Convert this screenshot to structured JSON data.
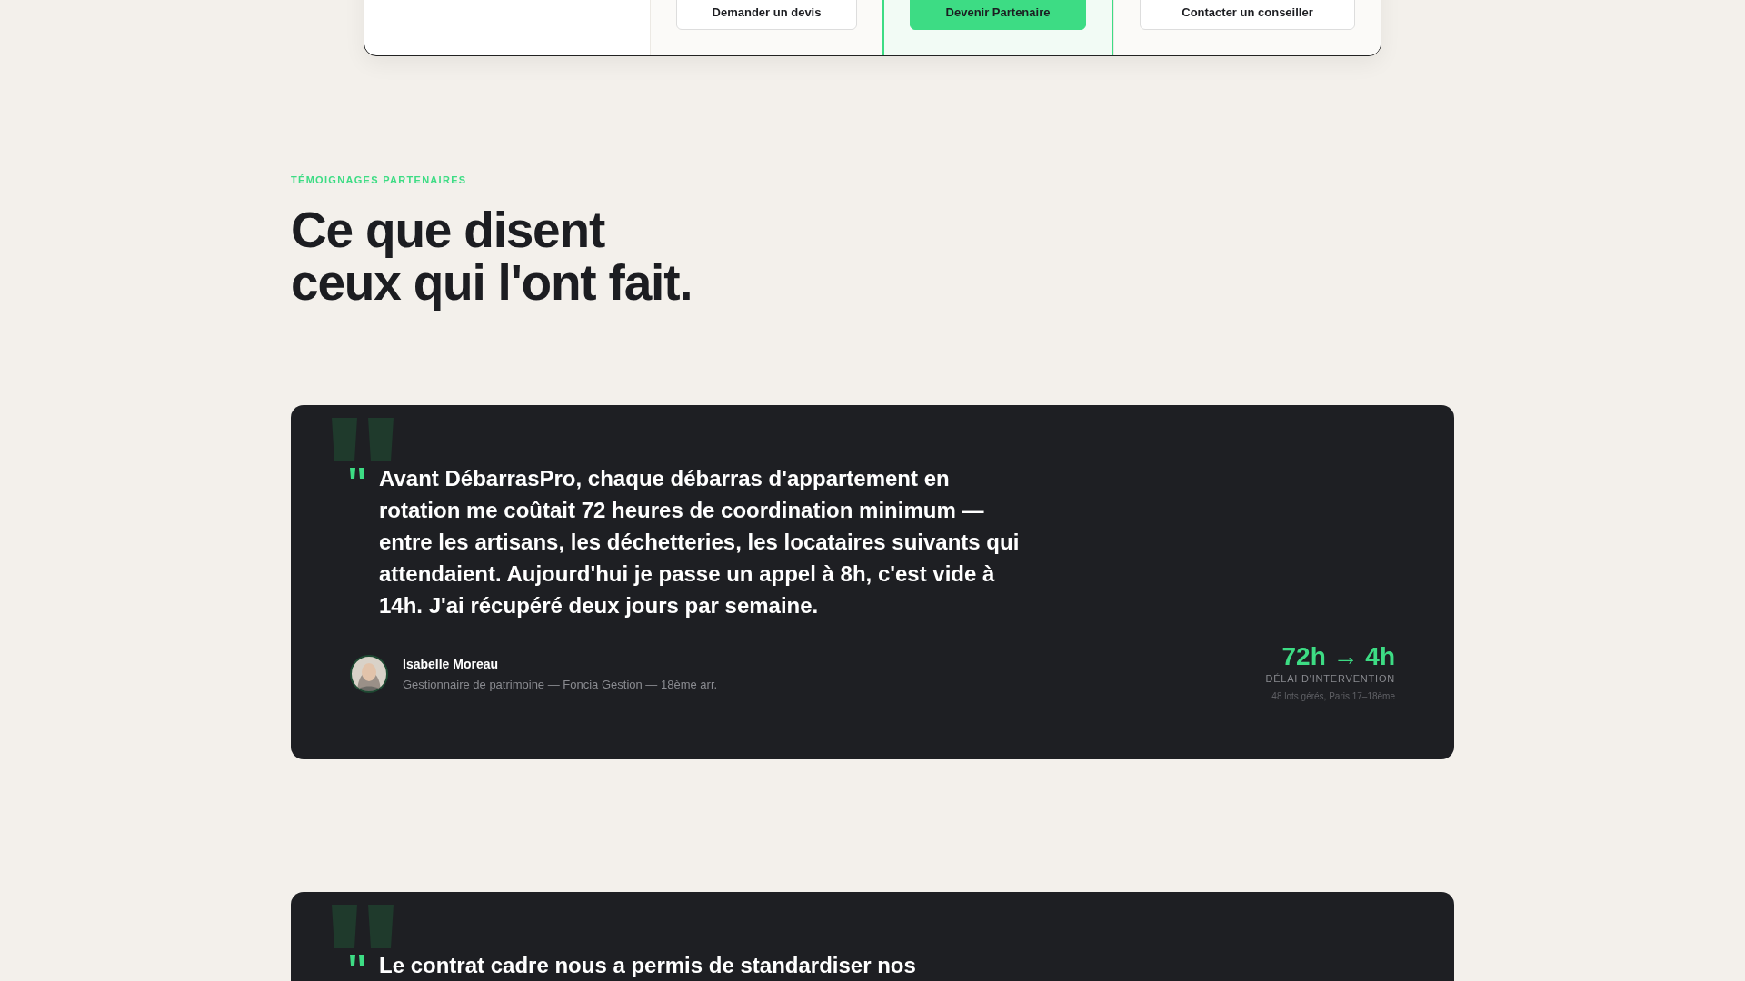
{
  "cta_bar": {
    "columns": [
      {
        "kind": "empty",
        "highlighted": false
      },
      {
        "kind": "button",
        "label": "Demander un devis",
        "highlighted": false
      },
      {
        "kind": "button",
        "label": "Devenir Partenaire",
        "highlighted": true
      },
      {
        "kind": "button",
        "label": "Contacter un conseiller",
        "highlighted": false
      }
    ]
  },
  "section": {
    "eyebrow": "TÉMOIGNAGES PARTENAIRES",
    "title_lines": [
      "Ce que disent",
      "ceux qui l'ont fait."
    ]
  },
  "testimonials": [
    {
      "quote": "Avant DébarrasPro, chaque débarras d'appartement en rotation me coûtait 72 heures de coordination minimum — entre les artisans, les déchetteries, les locataires suivants qui attendaient. Aujourd'hui je passe un appel à 8h, c'est vide à 14h. J'ai récupéré deux jours par semaine.",
      "author": {
        "name": "Isabelle Moreau",
        "role": "Gestionnaire de patrimoine — Foncia Gestion — 18ème arr."
      },
      "metric": {
        "value": "72h → 4h",
        "label": "DÉLAI D'INTERVENTION",
        "note": "48 lots gérés, Paris 17–18ème"
      }
    },
    {
      "quote": "Le contrat cadre nous a permis de standardiser nos"
    }
  ]
}
